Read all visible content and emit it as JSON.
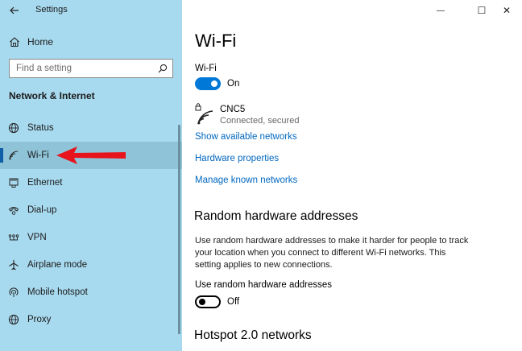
{
  "window": {
    "title": "Settings",
    "minimize_glyph": "—",
    "maximize_glyph": "☐",
    "close_glyph": "✕"
  },
  "sidebar": {
    "home_label": "Home",
    "search_placeholder": "Find a setting",
    "section_title": "Network & Internet",
    "items": [
      {
        "label": "Status",
        "icon": "globe-icon"
      },
      {
        "label": "Wi-Fi",
        "icon": "wifi-icon",
        "selected": true
      },
      {
        "label": "Ethernet",
        "icon": "ethernet-icon"
      },
      {
        "label": "Dial-up",
        "icon": "dialup-icon"
      },
      {
        "label": "VPN",
        "icon": "vpn-icon"
      },
      {
        "label": "Airplane mode",
        "icon": "airplane-icon"
      },
      {
        "label": "Mobile hotspot",
        "icon": "hotspot-icon"
      },
      {
        "label": "Proxy",
        "icon": "globe-icon"
      }
    ]
  },
  "main": {
    "title": "Wi-Fi",
    "wifi_toggle": {
      "label": "Wi-Fi",
      "state": "On"
    },
    "network": {
      "name": "CNC5",
      "status": "Connected, secured"
    },
    "links": {
      "show_available": "Show available networks",
      "hardware_properties": "Hardware properties",
      "manage_known": "Manage known networks"
    },
    "random_hw": {
      "heading": "Random hardware addresses",
      "description": "Use random hardware addresses to make it harder for people to track your location when you connect to different Wi-Fi networks. This setting applies to new connections.",
      "toggle_label": "Use random hardware addresses",
      "toggle_state": "Off"
    },
    "hotspot_heading": "Hotspot 2.0 networks"
  },
  "colors": {
    "sidebar_bg": "#a8daef",
    "selected_bg": "#8ec3d8",
    "accent": "#0078d7",
    "link": "#0067c0",
    "annotation_arrow": "#e8141c"
  }
}
